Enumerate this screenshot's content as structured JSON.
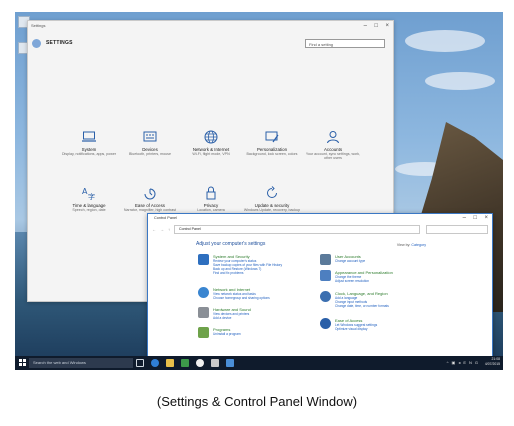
{
  "settings": {
    "window_title": "Settings",
    "header_title": "SETTINGS",
    "search_placeholder": "Find a setting",
    "tiles": [
      {
        "name": "System",
        "desc": "Display, notifications, apps, power"
      },
      {
        "name": "Devices",
        "desc": "Bluetooth, printers, mouse"
      },
      {
        "name": "Network & Internet",
        "desc": "Wi-Fi, flight mode, VPN"
      },
      {
        "name": "Personalization",
        "desc": "Background, lock screen, colors"
      },
      {
        "name": "Accounts",
        "desc": "Your account, sync settings, work, other users"
      },
      {
        "name": "Time & language",
        "desc": "Speech, region, date"
      },
      {
        "name": "Ease of Access",
        "desc": "Narrator, magnifier, high contrast"
      },
      {
        "name": "Privacy",
        "desc": "Location, camera"
      },
      {
        "name": "Update & security",
        "desc": "Windows Update, recovery, backup"
      }
    ]
  },
  "control_panel": {
    "window_title": "Control Panel",
    "path": "Control Panel",
    "heading": "Adjust your computer's settings",
    "view_by_label": "View by:",
    "view_by_value": "Category",
    "left_categories": [
      {
        "title": "System and Security",
        "links": [
          "Review your computer's status",
          "Save backup copies of your files with File History",
          "Back up and Restore (Windows 7)",
          "Find and fix problems"
        ]
      },
      {
        "title": "Network and Internet",
        "links": [
          "View network status and tasks",
          "Choose homegroup and sharing options"
        ]
      },
      {
        "title": "Hardware and Sound",
        "links": [
          "View devices and printers",
          "Add a device"
        ]
      },
      {
        "title": "Programs",
        "links": [
          "Uninstall a program"
        ]
      }
    ],
    "right_categories": [
      {
        "title": "User Accounts",
        "links": [
          "Change account type"
        ]
      },
      {
        "title": "Appearance and Personalization",
        "links": [
          "Change the theme",
          "Adjust screen resolution"
        ]
      },
      {
        "title": "Clock, Language, and Region",
        "links": [
          "Add a language",
          "Change input methods",
          "Change date, time, or number formats"
        ]
      },
      {
        "title": "Ease of Access",
        "links": [
          "Let Windows suggest settings",
          "Optimize visual display"
        ]
      }
    ]
  },
  "taskbar": {
    "search_placeholder": "Search the web and Windows",
    "time": "21:08",
    "date": "4/07/2015",
    "lang": "ENG"
  },
  "caption": "(Settings & Control Panel Window)",
  "colors": {
    "accent": "#1f5fbf",
    "cp_heading": "#1e4f9c",
    "category_title": "#2a7a2a"
  }
}
